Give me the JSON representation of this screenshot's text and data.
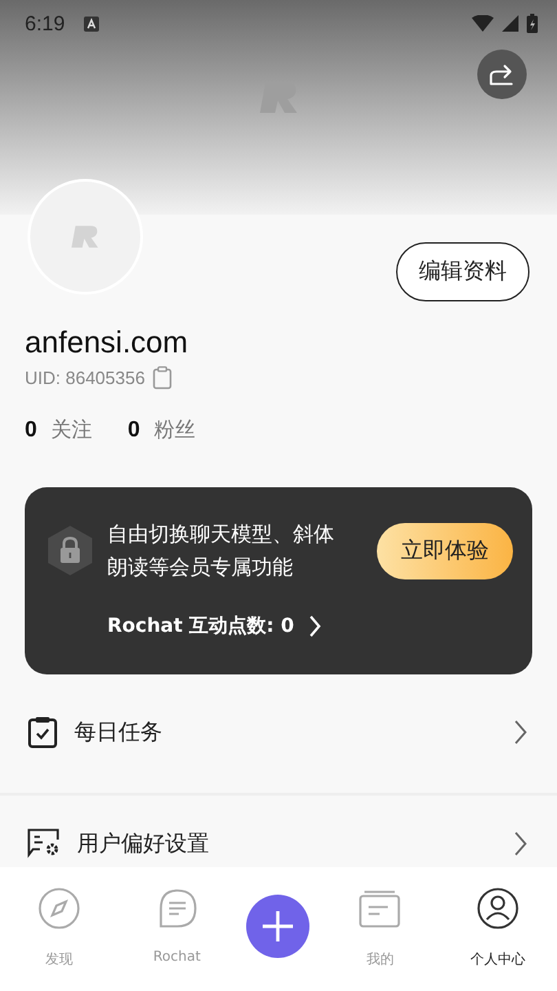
{
  "status_bar": {
    "time": "6:19"
  },
  "profile": {
    "edit_button": "编辑资料",
    "name": "anfensi.com",
    "uid": "UID: 86405356",
    "stats": [
      {
        "count": "0",
        "label": "关注"
      },
      {
        "count": "0",
        "label": "粉丝"
      }
    ]
  },
  "vip_card": {
    "text": "自由切换聊天模型、斜体朗读等会员专属功能",
    "button": "立即体验",
    "points": "Rochat 互动点数: 0"
  },
  "menu": [
    {
      "kind": "task",
      "label": "每日任务"
    },
    {
      "kind": "preference",
      "label": "用户偏好设置"
    }
  ],
  "tab_bar": [
    {
      "kind": "discover",
      "label": "发现",
      "selected": false
    },
    {
      "kind": "chat",
      "label": "Rochat",
      "selected": false
    },
    {
      "kind": "add"
    },
    {
      "kind": "mine",
      "label": "我的",
      "selected": false
    },
    {
      "kind": "profile",
      "label": "个人中心",
      "selected": true
    }
  ]
}
